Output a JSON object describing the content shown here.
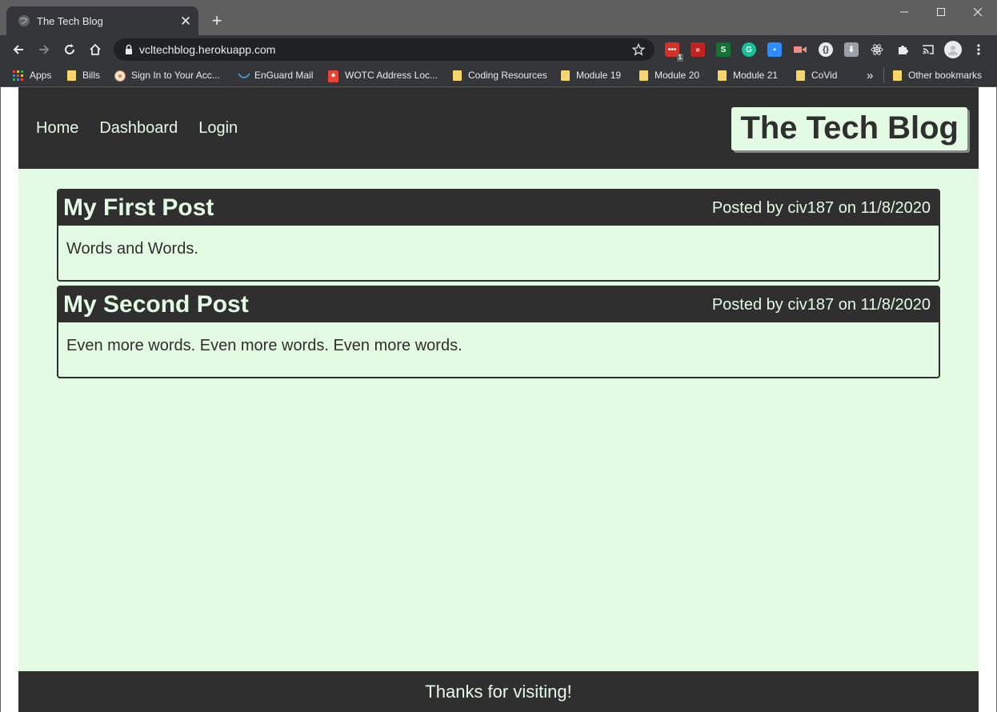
{
  "browser": {
    "tab_title": "The Tech Blog",
    "url": "vcltechblog.herokuapp.com",
    "new_tab_symbol": "+",
    "close_symbol": "✕",
    "extension_badge": "1",
    "bookmarks": [
      {
        "label": "Apps",
        "icon": "apps-grid-icon"
      },
      {
        "label": "Bills",
        "icon": "folder-icon"
      },
      {
        "label": "Sign In to Your Acc...",
        "icon": "site-icon"
      },
      {
        "label": "EnGuard Mail",
        "icon": "site-icon"
      },
      {
        "label": "WOTC Address Loc...",
        "icon": "map-pin-icon"
      },
      {
        "label": "Coding Resources",
        "icon": "folder-icon"
      },
      {
        "label": "Module 19",
        "icon": "folder-icon"
      },
      {
        "label": "Module 20",
        "icon": "folder-icon"
      },
      {
        "label": "Module 21",
        "icon": "folder-icon"
      },
      {
        "label": "CoVid",
        "icon": "folder-icon"
      }
    ],
    "overflow_symbol": "»",
    "other_bookmarks": "Other bookmarks"
  },
  "site": {
    "nav": [
      "Home",
      "Dashboard",
      "Login"
    ],
    "brand": "The Tech Blog",
    "posts": [
      {
        "title": "My First Post",
        "meta": "Posted by civ187 on 11/8/2020",
        "body": "Words and Words."
      },
      {
        "title": "My Second Post",
        "meta": "Posted by civ187 on 11/8/2020",
        "body": "Even more words. Even more words. Even more words."
      }
    ],
    "footer": "Thanks for visiting!"
  },
  "colors": {
    "header_dark": "#2f2f2f",
    "page_mint": "#e3fbe3",
    "chrome_dark": "#35363a"
  }
}
